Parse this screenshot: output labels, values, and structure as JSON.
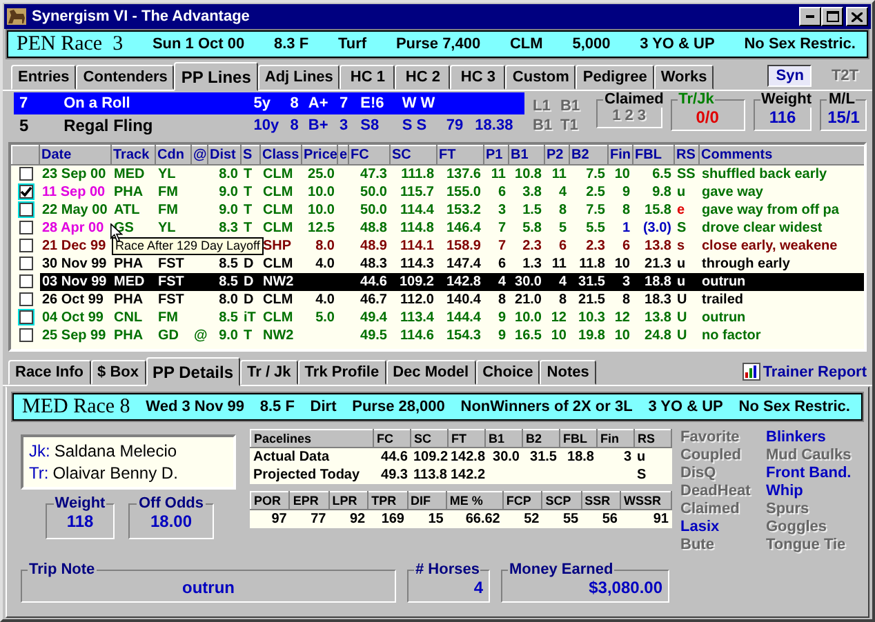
{
  "window": {
    "title": "Synergism VI - The Advantage"
  },
  "race_header": {
    "title": "PEN Race  3",
    "items": [
      "Sun 1 Oct 00",
      "8.3 F",
      "Turf",
      "Purse 7,400",
      "CLM",
      "5,000",
      "3 YO & UP",
      "No Sex Restric."
    ]
  },
  "tabs": [
    {
      "label": "Entries",
      "selected": false
    },
    {
      "label": "Contenders",
      "selected": false
    },
    {
      "label": "PP Lines",
      "selected": true
    },
    {
      "label": "Adj Lines",
      "selected": false
    },
    {
      "label": "HC 1",
      "selected": false
    },
    {
      "label": "HC 2",
      "selected": false
    },
    {
      "label": "HC 3",
      "selected": false
    },
    {
      "label": "Custom",
      "selected": false
    },
    {
      "label": "Pedigree",
      "selected": false
    },
    {
      "label": "Works",
      "selected": false
    }
  ],
  "toggles": [
    {
      "label": "Syn",
      "on": true
    },
    {
      "label": "T2T",
      "on": false
    }
  ],
  "horses": [
    {
      "post": "7",
      "name": "On a Roll",
      "selected": true,
      "cells": [
        "5y",
        "8",
        "A+",
        "7",
        "E!6",
        "W W",
        null,
        null
      ]
    },
    {
      "post": "5",
      "name": "Regal Fling",
      "selected": false,
      "cells": [
        "10y",
        "8",
        "B+",
        "3",
        "S8",
        "S S",
        "79",
        "18.38"
      ]
    }
  ],
  "markers": [
    "L1",
    "B1",
    "B1",
    "T1"
  ],
  "claimed": {
    "label": "Claimed",
    "options": [
      "1",
      "2",
      "3"
    ]
  },
  "trjk": {
    "label": "Tr/Jk",
    "value": "0/0"
  },
  "weight": {
    "label": "Weight",
    "value": "116"
  },
  "ml": {
    "label": "M/L",
    "value": "15/1"
  },
  "table": {
    "columns": [
      "Date",
      "Track",
      "Cdn",
      "@",
      "Dist",
      "S",
      "Class",
      "Price",
      "e",
      "FC",
      "SC",
      "FT",
      "P1",
      "B1",
      "P2",
      "B2",
      "Fin",
      "FBL",
      "RS",
      "Comments"
    ],
    "rows": [
      {
        "checked": false,
        "highlighted": false,
        "selected": false,
        "color": "#007000",
        "cells": [
          "23 Sep 00",
          "MED",
          "YL",
          null,
          "8.0",
          "T",
          "CLM",
          "25.0",
          null,
          "47.3",
          "111.8",
          "137.6",
          "11",
          "10.8",
          "11",
          "7.5",
          "10",
          "6.5",
          "SS",
          "shuffled back early"
        ]
      },
      {
        "checked": true,
        "highlighted": true,
        "selected": false,
        "color": "#007000",
        "cells": [
          {
            "text": "11 Sep 00",
            "color": "#e000e0"
          },
          "PHA",
          "FM",
          null,
          "9.0",
          "T",
          "CLM",
          "10.0",
          null,
          "50.0",
          "115.7",
          "155.0",
          "6",
          "3.8",
          "4",
          "2.5",
          "9",
          "9.8",
          "u",
          "gave way"
        ]
      },
      {
        "checked": false,
        "highlighted": true,
        "selected": false,
        "color": "#007000",
        "cells": [
          "22 May 00",
          "ATL",
          "FM",
          null,
          "9.0",
          "T",
          "CLM",
          "10.0",
          null,
          "50.0",
          "114.4",
          "153.2",
          "3",
          "1.5",
          "8",
          "7.5",
          "8",
          "15.8",
          {
            "text": "e",
            "color": "#e00000"
          },
          "gave way from off pa"
        ]
      },
      {
        "checked": false,
        "highlighted": false,
        "selected": false,
        "color": "#007000",
        "cells": [
          {
            "text": "28 Apr 00",
            "color": "#e000e0"
          },
          "GS",
          "YL",
          null,
          "8.3",
          "T",
          "CLM",
          "12.5",
          null,
          "48.8",
          "114.8",
          "146.4",
          "7",
          "5.8",
          "5",
          "5.5",
          {
            "text": "1",
            "color": "#0000c0"
          },
          {
            "text": "(3.0)",
            "color": "#0000c0"
          },
          "S",
          "drove clear widest"
        ]
      },
      {
        "checked": false,
        "highlighted": false,
        "selected": false,
        "color": "#800000",
        "tooltip": "Race After 129 Day Layoff",
        "cells": [
          "21 Dec 99",
          null,
          null,
          null,
          null,
          null,
          "SHP",
          "8.0",
          null,
          "48.9",
          "114.1",
          "158.9",
          "7",
          "2.3",
          "6",
          "2.3",
          "6",
          "13.8",
          "s",
          "close early, weakene"
        ]
      },
      {
        "checked": false,
        "highlighted": false,
        "selected": false,
        "color": "#000000",
        "cells": [
          "30 Nov 99",
          "PHA",
          "FST",
          null,
          "8.5",
          "D",
          "CLM",
          "4.0",
          null,
          "48.3",
          "114.3",
          "147.4",
          "6",
          "1.3",
          "11",
          "11.8",
          "10",
          "21.3",
          "u",
          "through early"
        ]
      },
      {
        "checked": false,
        "highlighted": false,
        "selected": true,
        "cells": [
          "03 Nov 99",
          "MED",
          "FST",
          null,
          "8.5",
          "D",
          "NW2",
          null,
          null,
          "44.6",
          "109.2",
          "142.8",
          "4",
          "30.0",
          "4",
          "31.5",
          "3",
          "18.8",
          "u",
          "outrun"
        ]
      },
      {
        "checked": false,
        "highlighted": false,
        "selected": false,
        "color": "#000000",
        "cells": [
          "26 Oct 99",
          "PHA",
          "FST",
          null,
          "8.0",
          "D",
          "CLM",
          "4.0",
          null,
          "46.7",
          "112.0",
          "140.4",
          "8",
          "21.0",
          "8",
          "21.5",
          "8",
          "18.3",
          "U",
          "trailed"
        ]
      },
      {
        "checked": false,
        "highlighted": true,
        "selected": false,
        "color": "#007000",
        "cells": [
          "04 Oct 99",
          "CNL",
          "FM",
          null,
          "8.5",
          "iT",
          "CLM",
          "5.0",
          null,
          "49.4",
          "113.4",
          "144.4",
          "9",
          "10.0",
          "12",
          "10.3",
          "12",
          "13.8",
          "U",
          "outrun"
        ]
      },
      {
        "checked": false,
        "highlighted": false,
        "selected": false,
        "color": "#007000",
        "cells": [
          "25 Sep 99",
          "PHA",
          "GD",
          "@",
          "9.0",
          "T",
          "NW2",
          null,
          null,
          "49.5",
          "114.6",
          "154.3",
          "9",
          "16.5",
          "10",
          "19.8",
          "10",
          "24.8",
          "U",
          "no factor"
        ]
      }
    ]
  },
  "detail_tabs": [
    {
      "label": "Race Info",
      "selected": false
    },
    {
      "label": "$ Box",
      "selected": false
    },
    {
      "label": "PP Details",
      "selected": true
    },
    {
      "label": "Tr / Jk",
      "selected": false
    },
    {
      "label": "Trk Profile",
      "selected": false
    },
    {
      "label": "Dec Model",
      "selected": false
    },
    {
      "label": "Choice",
      "selected": false
    },
    {
      "label": "Notes",
      "selected": false
    }
  ],
  "trainer_report": "Trainer Report",
  "detail": {
    "race_header": {
      "title": "MED Race 8",
      "items": [
        "Wed 3 Nov 99",
        "8.5 F",
        "Dirt",
        "Purse 28,000",
        "NonWinners of 2X or 3L",
        "3 YO & UP",
        "No Sex Restric."
      ]
    },
    "people": [
      {
        "label": "Jk:",
        "name": "Saldana Melecio"
      },
      {
        "label": "Tr:",
        "name": "Olaivar Benny D."
      }
    ],
    "pacelines": {
      "columns": [
        "Pacelines",
        "FC",
        "SC",
        "FT",
        "B1",
        "B2",
        "FBL",
        "Fin",
        "RS"
      ],
      "rows": [
        [
          "Actual Data",
          "44.6",
          "109.2",
          "142.8",
          "30.0",
          "31.5",
          "18.8",
          "3",
          "u"
        ],
        [
          "Projected Today",
          "49.3",
          "113.8",
          "142.2",
          null,
          null,
          null,
          null,
          "S"
        ]
      ]
    },
    "stats": {
      "columns": [
        "POR",
        "EPR",
        "LPR",
        "TPR",
        "DIF",
        "ME %",
        "FCP",
        "SCP",
        "SSR",
        "WSSR"
      ],
      "values": [
        "97",
        "77",
        "92",
        "169",
        "15",
        "66.62",
        "52",
        "55",
        "56",
        "91"
      ]
    },
    "weight": {
      "label": "Weight",
      "value": "118"
    },
    "odds": {
      "label": "Off Odds",
      "value": "18.00"
    },
    "flags": [
      {
        "label": "Favorite",
        "on": false
      },
      {
        "label": "Coupled",
        "on": false
      },
      {
        "label": "DisQ",
        "on": false
      },
      {
        "label": "DeadHeat",
        "on": false
      },
      {
        "label": "Claimed",
        "on": false
      },
      {
        "label": "Lasix",
        "on": true
      },
      {
        "label": "Bute",
        "on": false
      },
      {
        "label": "Blinkers",
        "on": true
      },
      {
        "label": "Mud Caulks",
        "on": false
      },
      {
        "label": "Front Band.",
        "on": true
      },
      {
        "label": "Whip",
        "on": true
      },
      {
        "label": "Spurs",
        "on": false
      },
      {
        "label": "Goggles",
        "on": false
      },
      {
        "label": "Tongue Tie",
        "on": false
      }
    ],
    "trip_note": {
      "label": "Trip Note",
      "value": "outrun"
    },
    "horses": {
      "label": "# Horses",
      "value": "4"
    },
    "money": {
      "label": "Money Earned",
      "value": "$3,080.00"
    }
  }
}
